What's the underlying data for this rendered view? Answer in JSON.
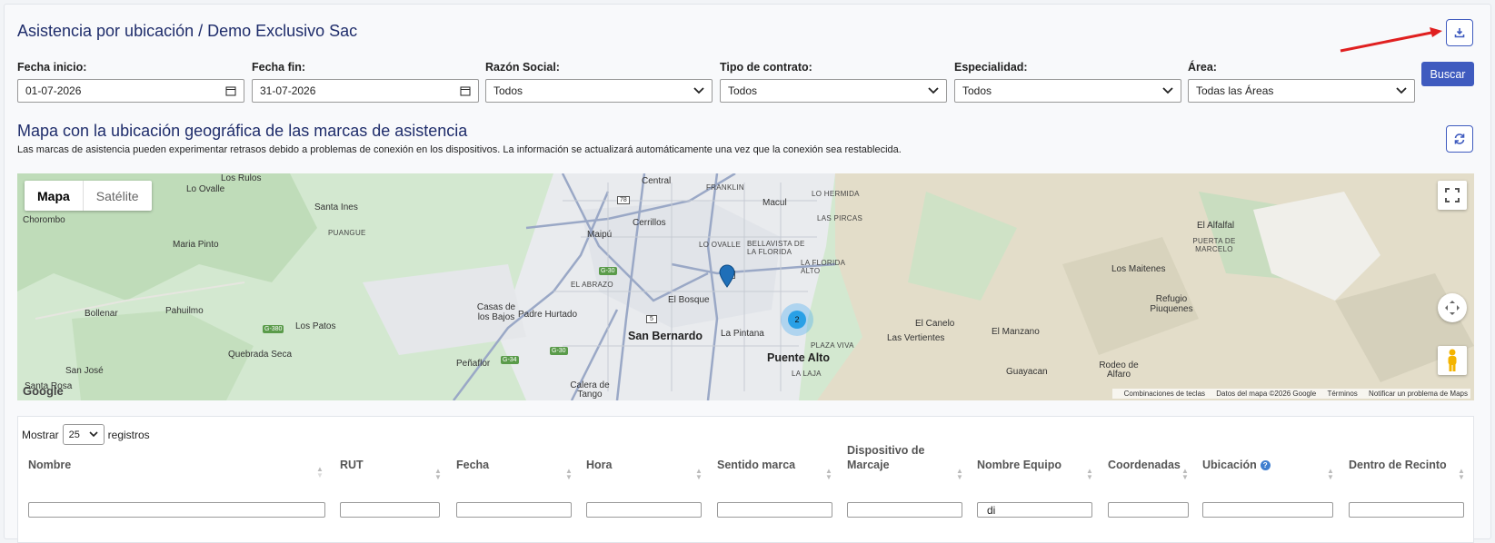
{
  "header": {
    "title": "Asistencia por ubicación / Demo Exclusivo Sac",
    "export_icon": "download-icon"
  },
  "filters": [
    {
      "label": "Fecha inicio:",
      "value": "01-07-2026",
      "kind": "date"
    },
    {
      "label": "Fecha fin:",
      "value": "31-07-2026",
      "kind": "date"
    },
    {
      "label": "Razón Social:",
      "value": "Todos",
      "kind": "select"
    },
    {
      "label": "Tipo de contrato:",
      "value": "Todos",
      "kind": "select"
    },
    {
      "label": "Especialidad:",
      "value": "Todos",
      "kind": "select"
    },
    {
      "label": "Área:",
      "value": "Todas las Áreas",
      "kind": "select"
    }
  ],
  "search_button": "Buscar",
  "map_section": {
    "title": "Mapa con la ubicación geográfica de las marcas de asistencia",
    "subtitle": "Las marcas de asistencia pueden experimentar retrasos debido a problemas de conexión en los dispositivos. La información se actualizará automáticamente una vez que la conexión sea restablecida.",
    "map_type_active": "Mapa",
    "map_type_other": "Satélite",
    "cluster_count": "2",
    "google": "Google",
    "footer": [
      "Combinaciones de teclas",
      "Datos del mapa ©2026 Google",
      "Términos",
      "Notificar un problema de Maps"
    ],
    "places": {
      "los_rulos": "Los Rulos",
      "lo_ovalle_w": "Lo Ovalle",
      "chorombo": "Chorombo",
      "santa_ines": "Santa Ines",
      "puangue": "PUANGUE",
      "maria_pinto": "Maria Pinto",
      "bollenar": "Bollenar",
      "pahuilmo": "Pahuilmo",
      "los_patos": "Los Patos",
      "quebrada_seca": "Quebrada Seca",
      "san_jose": "San José",
      "santa_rosa": "Santa Rosa",
      "penaflor": "Peñaflor",
      "calera": "Calera de Tango",
      "casas": "Casas de los Bajos",
      "padre_hurtado": "Padre Hurtado",
      "el_abrazo": "EL ABRAZO",
      "maipu": "Maipú",
      "cerrillos": "Cerrillos",
      "central": "Central",
      "franklin": "FRANKLIN",
      "macul": "Macul",
      "lo_hermida": "LO HERMIDA",
      "las_pircas": "LAS PIRCAS",
      "lo_ovalle": "LO OVALLE",
      "bellavista": "BELLAVISTA DE LA FLORIDA",
      "la_florida_alto": "LA FLORIDA ALTO",
      "el_bosque": "El Bosque",
      "san_bernardo": "San Bernardo",
      "la_pintana": "La Pintana",
      "puente_alto": "Puente Alto",
      "plaza_viva": "PLAZA VIVA",
      "la_laja": "LA LAJA",
      "el_canelo": "El Canelo",
      "las_vertientes": "Las Vertientes",
      "el_manzano": "El Manzano",
      "el_alfalfal": "El Alfalfal",
      "puerta_marcelo": "PUERTA DE MARCELO",
      "los_maitenes": "Los Maitenes",
      "refugio": "Refugio Piuquenes",
      "guayacan": "Guayacan",
      "rodeo": "Rodeo de Alfaro",
      "g30a": "G-30",
      "g30b": "G-30",
      "g34": "G-34",
      "g380": "G-380",
      "r5": "5",
      "r70": "70",
      "r78": "78"
    }
  },
  "table": {
    "show_label": "Mostrar",
    "page_size": "25",
    "records_label": "registros",
    "columns": [
      "Nombre",
      "RUT",
      "Fecha",
      "Hora",
      "Sentido marca",
      "Dispositivo de Marcaje",
      "Nombre Equipo",
      "Coordenadas",
      "Ubicación",
      "Dentro de Recinto"
    ],
    "filter_values": [
      "",
      "",
      "",
      "",
      "",
      "",
      "di",
      "",
      "",
      ""
    ]
  }
}
